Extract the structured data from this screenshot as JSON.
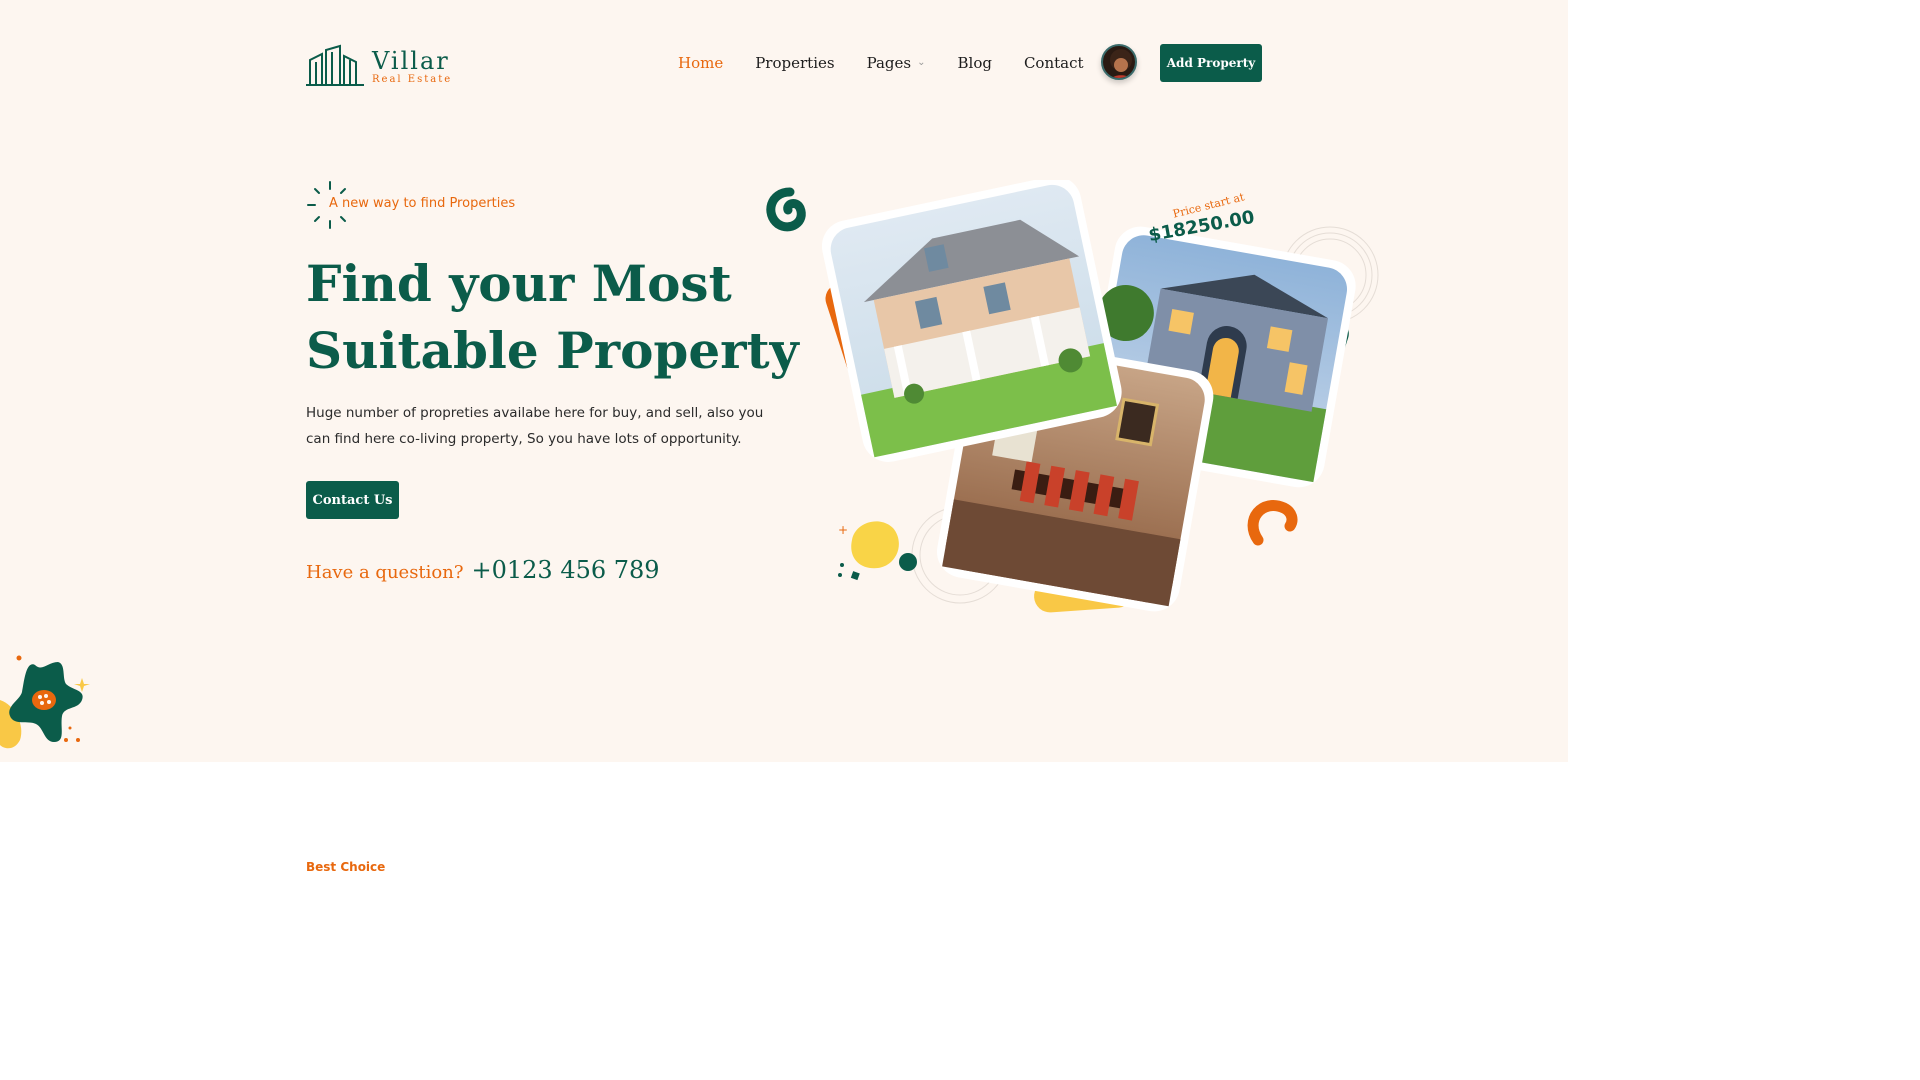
{
  "brand": {
    "name": "Villar",
    "subtitle": "Real Estate",
    "primary_color": "#0b5c4a",
    "accent_color": "#e8680e",
    "yellow_color": "#f9c846"
  },
  "nav": {
    "items": [
      {
        "label": "Home",
        "active": true
      },
      {
        "label": "Properties",
        "active": false
      },
      {
        "label": "Pages",
        "active": false,
        "dropdown": true
      },
      {
        "label": "Blog",
        "active": false
      },
      {
        "label": "Contact",
        "active": false
      }
    ],
    "dropdown_icon": "chevron-down-icon",
    "add_property_label": "Add Property"
  },
  "hero": {
    "tagline": "A new way to find Properties",
    "headline_line1": "Find your Most",
    "headline_line2": "Suitable Property",
    "description": "Huge number of propreties availabe here for buy, and sell, also you can find here co-living property, So you have lots of opportunity.",
    "cta_label": "Contact Us",
    "question_label": "Have a question?",
    "phone": "+0123 456 789",
    "price_label": "Price start at",
    "price_value": "$18250.00"
  },
  "next_section": {
    "label": "Best Choice"
  }
}
